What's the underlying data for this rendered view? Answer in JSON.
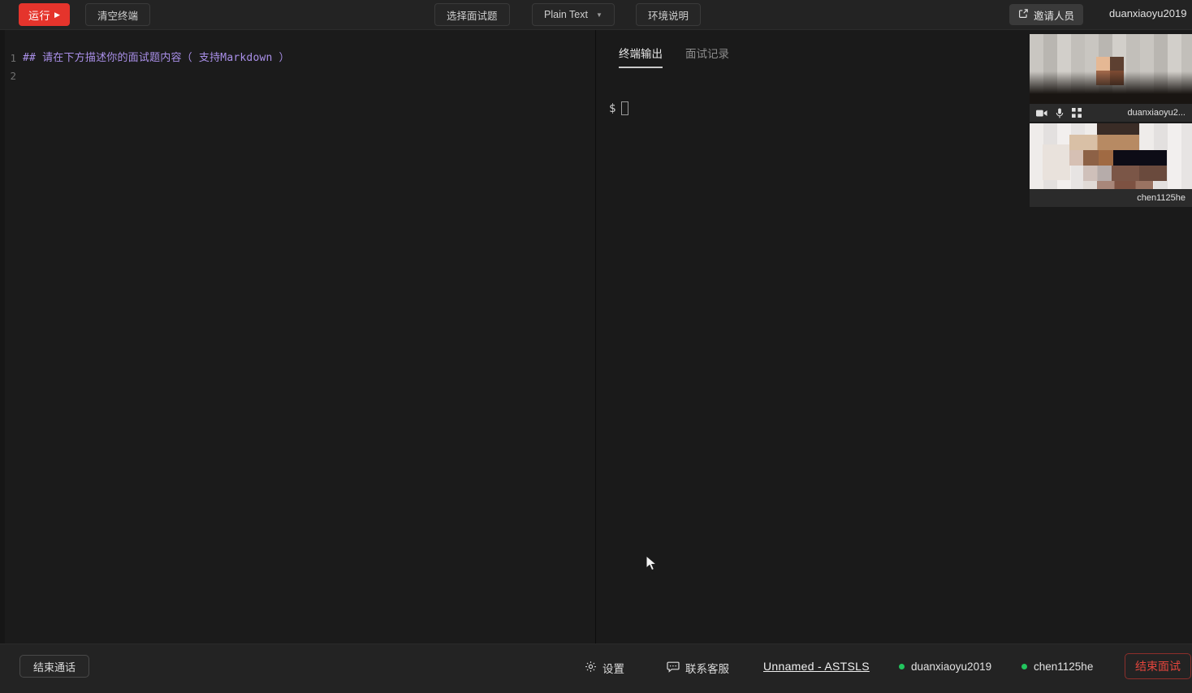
{
  "topbar": {
    "run_label": "运行",
    "run_icon": "play-triangle-icon",
    "clear_label": "清空终端",
    "choose_label": "选择面试题",
    "language_label": "Plain Text",
    "env_label": "环境说明",
    "invite_label": "邀请人员",
    "invite_icon": "external-link-icon",
    "username": "duanxiaoyu2019",
    "caret": "▾"
  },
  "editor": {
    "lines": [
      {
        "number": "1",
        "text": "## 请在下方描述你的面试题内容（ 支持Markdown ）"
      },
      {
        "number": "2",
        "text": ""
      }
    ],
    "syntax_color": "#a98fe8"
  },
  "terminal": {
    "tabs": [
      {
        "label": "终端输出",
        "active": true
      },
      {
        "label": "面试记录",
        "active": false
      }
    ],
    "prompt_symbol": "$",
    "cursor": "block-cursor"
  },
  "videos": [
    {
      "name": "duanxiaoyu2...",
      "controls": [
        "camera-icon",
        "microphone-icon",
        "fullscreen-icon"
      ]
    },
    {
      "name": "chen1125he",
      "controls": []
    }
  ],
  "bottombar": {
    "end_call_label": "结束通话",
    "settings_label": "设置",
    "settings_icon": "gear-icon",
    "support_label": "联系客服",
    "support_icon": "chat-bubble-icon",
    "room_name": "Unnamed - ASTSLS",
    "participants": [
      {
        "name": "duanxiaoyu2019",
        "status_color": "#22c55e"
      },
      {
        "name": "chen1125he",
        "status_color": "#22c55e"
      }
    ],
    "end_interview_label": "结束面试",
    "end_interview_color": "#e2453c"
  },
  "colors": {
    "accent_red": "#e5342c",
    "panel_bg": "#1a1a1a",
    "bar_bg": "#232323",
    "online_green": "#22c55e"
  }
}
